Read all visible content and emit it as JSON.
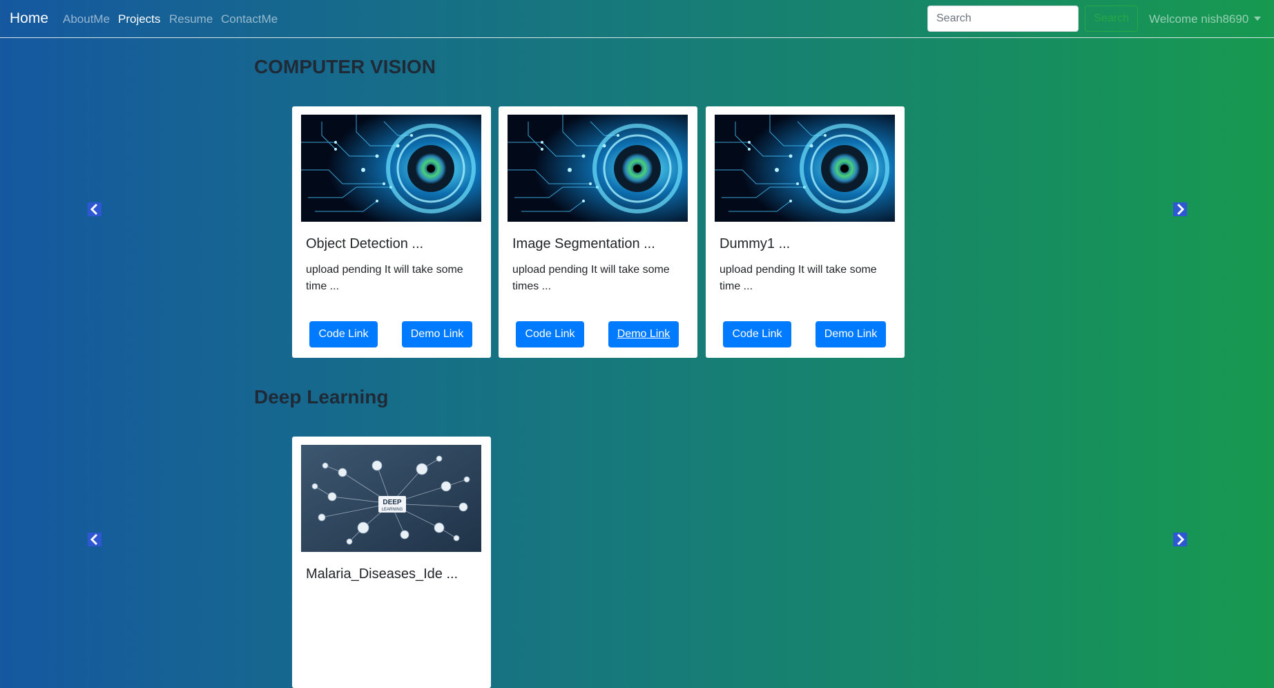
{
  "nav": {
    "brand": "Home",
    "links": [
      "AboutMe",
      "Projects",
      "Resume",
      "ContactMe"
    ],
    "active": "Projects",
    "search_placeholder": "Search",
    "search_button": "Search",
    "welcome": "Welcome nish8690"
  },
  "sections": [
    {
      "title": "COMPUTER VISION",
      "cards": [
        {
          "title": "Object Detection ...",
          "text": "upload pending It will take some time ...",
          "code": "Code Link",
          "demo": "Demo Link"
        },
        {
          "title": "Image Segmentation ...",
          "text": "upload pending It will take some times ...",
          "code": "Code Link",
          "demo": "Demo Link"
        },
        {
          "title": "Dummy1 ...",
          "text": "upload pending It will take some time ...",
          "code": "Code Link",
          "demo": "Demo Link"
        }
      ]
    },
    {
      "title": "Deep Learning",
      "cards": [
        {
          "title": "Malaria_Diseases_Ide ...",
          "image_label_1": "DEEP",
          "image_label_2": "LEARNING"
        }
      ]
    }
  ],
  "colors": {
    "primary": "#007bff",
    "success": "#28a745",
    "carousel_arrow": "#2d57d3"
  },
  "icons": {
    "prev": "chevron-left-icon",
    "next": "chevron-right-icon"
  }
}
